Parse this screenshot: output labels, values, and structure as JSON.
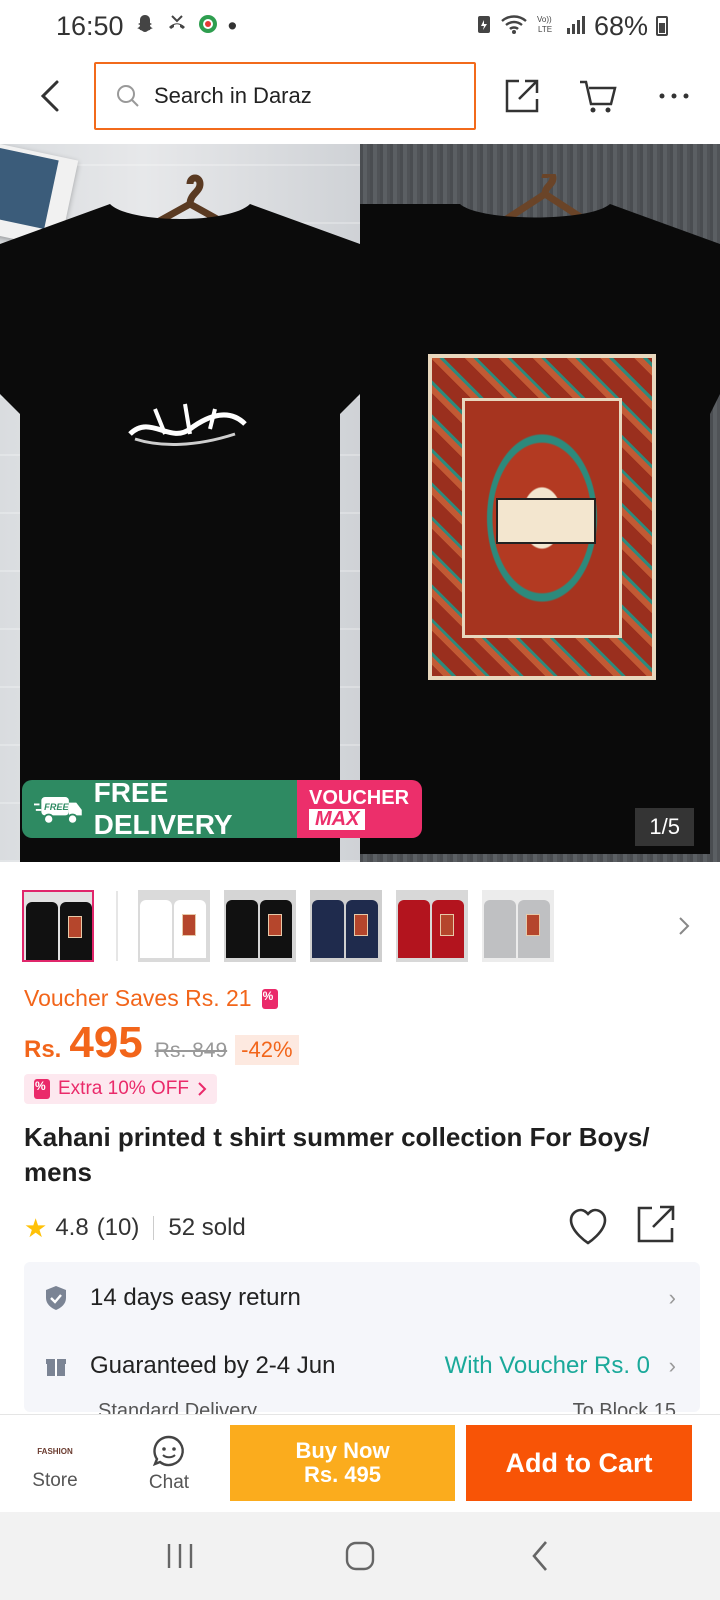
{
  "status_bar": {
    "time": "16:50",
    "dot": "•",
    "battery": "68%",
    "icons": [
      "snapchat-icon",
      "missed-call-icon",
      "app-icon",
      "battery-saver-icon",
      "wifi-icon",
      "volte-icon",
      "signal-icon",
      "battery-icon"
    ]
  },
  "header": {
    "search_placeholder": "Search in Daraz"
  },
  "gallery": {
    "counter": "1/5",
    "banner": {
      "free_badge": "FREE",
      "free_delivery": "FREE DELIVERY",
      "voucher": "VOUCHER",
      "max": "MAX"
    },
    "thumbnails": [
      {
        "color": "#111111",
        "active": true
      },
      {
        "color": "#ffffff",
        "active": false
      },
      {
        "color": "#111111",
        "active": false
      },
      {
        "color": "#1f2b4d",
        "active": false
      },
      {
        "color": "#b3141e",
        "active": false
      },
      {
        "color": "#bfc0c2",
        "active": false
      }
    ]
  },
  "pricing": {
    "voucher_saves": "Voucher Saves Rs. 21",
    "currency": "Rs.",
    "price": "495",
    "original": "Rs. 849",
    "discount": "-42%",
    "extra_off": "Extra 10% OFF"
  },
  "product": {
    "title": "Kahani printed t shirt summer collection For Boys/ mens",
    "rating": "4.8",
    "reviews": "(10)",
    "sold": "52 sold"
  },
  "info": {
    "returns": "14 days easy return",
    "delivery": "Guaranteed by 2-4 Jun",
    "with_voucher": "With Voucher Rs. 0",
    "standard": "Standard Delivery",
    "location": "To Block 15"
  },
  "bottom_bar": {
    "store_label": "Store",
    "store_logo": "FASHION",
    "chat_label": "Chat",
    "buy_now_line1": "Buy Now",
    "buy_now_line2": "Rs. 495",
    "add_to_cart": "Add to Cart"
  },
  "colors": {
    "accent_orange": "#f85406",
    "buy_now_yellow": "#fbac1d",
    "voucher_pink": "#ec2f6b",
    "delivery_green": "#2e8a62",
    "teal_text": "#1aa99a"
  }
}
